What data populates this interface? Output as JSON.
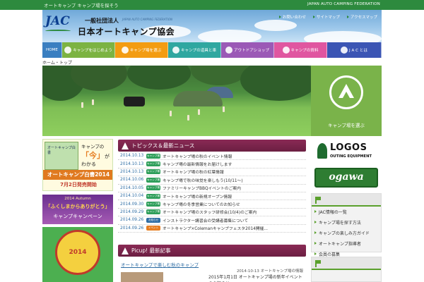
{
  "topbar": {
    "tagline": "オートキャンプ キャンプ場を探そう",
    "english_name": "JAPAN AUTO CAMPING FEDERATION"
  },
  "header": {
    "logo_text": "JAC",
    "org_prefix": "一般社団法人",
    "org_english": "JAPAN AUTO CAMPING FEDERATION",
    "org_name": "日本オートキャンプ協会",
    "links": [
      "お問い合わせ",
      "サイトマップ",
      "アクセスマップ"
    ]
  },
  "nav": [
    {
      "label": "HOME",
      "color": "#3a7fc1",
      "icon": "home"
    },
    {
      "label": "キャンプをはじめよう",
      "color": "#7cb342",
      "icon": "leaf-icon"
    },
    {
      "label": "キャンプ場を選ぶ",
      "color": "#f39c12",
      "icon": "tent-icon"
    },
    {
      "label": "キャンプの道具と車",
      "color": "#2fa7a0",
      "icon": "gear-icon"
    },
    {
      "label": "アウトドアショップ",
      "color": "#9b59b6",
      "icon": "shop-icon"
    },
    {
      "label": "キャンプの資料",
      "color": "#e056a0",
      "icon": "book-icon"
    },
    {
      "label": "J A C とは",
      "color": "#3b55b4",
      "icon": "question-icon"
    }
  ],
  "breadcrumb": "ホーム・トップ",
  "hero_cta": "キャンプ場を選ぶ",
  "banners": {
    "whitepaper": {
      "cover": "オートキャンプ白書",
      "line1": "キャンプの",
      "big": "「今」",
      "line2": "がわかる",
      "line3": "",
      "bar": "オートキャンプ白書2014",
      "date": "7月2日発売開始"
    },
    "campaign": {
      "line1": "2014 Autumn",
      "line2": "「ふくしまからありがとう」",
      "line3": "キャンプキャンペーン"
    },
    "event": {
      "year": "2014"
    }
  },
  "news": {
    "heading": "トピックス＆最新ニュース",
    "items": [
      {
        "date": "2014.10.13",
        "tag": "キャンプ場",
        "tag_color": "#2e9e5a",
        "title": "オートキャンプ場の秋のイベント情報"
      },
      {
        "date": "2014.10.13",
        "tag": "キャンプ場",
        "tag_color": "#2e9e5a",
        "title": "キャンプ場の最新情報をお届けします"
      },
      {
        "date": "2014.10.13",
        "tag": "キャンプ場",
        "tag_color": "#2e9e5a",
        "title": "オートキャンプ場の秋の紅葉情報"
      },
      {
        "date": "2014.10.06",
        "tag": "キャンプ場",
        "tag_color": "#2e9e5a",
        "title": "キャンプ場で秋の味覚を楽しもう(10/11～)"
      },
      {
        "date": "2014.10.05",
        "tag": "キャンプ場",
        "tag_color": "#2e9e5a",
        "title": "ファミリーキャンプBBQイベントのご案内"
      },
      {
        "date": "2014.10.04",
        "tag": "キャンプ場",
        "tag_color": "#2e9e5a",
        "title": "オートキャンプ場の新規オープン情報"
      },
      {
        "date": "2014.09.30",
        "tag": "キャンプ場",
        "tag_color": "#2e9e5a",
        "title": "キャンプ場の冬季営業についてのお知らせ"
      },
      {
        "date": "2014.09.29",
        "tag": "キャンプ場",
        "tag_color": "#2e9e5a",
        "title": "オートキャンプ場のスタッフ研修会(10/4)のご案内"
      },
      {
        "date": "2014.09.26",
        "tag": "お知らせ",
        "tag_color": "#2e6da4",
        "title": "インストラクター講習会の受講者募集について"
      },
      {
        "date": "2014.09.26",
        "tag": "イベント",
        "tag_color": "#e67e22",
        "title": "オートキャンプ×Colemanキャンプフェスタ2014開催..."
      }
    ]
  },
  "picup": {
    "heading": "Picup! 最新記事",
    "title": "オートキャンプで楽しむ秋のキャンプ",
    "meta": "2014-10-13 オートキャンプ場の情報",
    "excerpt": "2015年1月1日 オートキャンプ場の新年イベントのお知らせ"
  },
  "sponsors": {
    "logos": {
      "word": "LOGOS",
      "sub": "OUTING EQUIPMENT"
    },
    "ogawa": {
      "word": "ogawa"
    }
  },
  "sidebar": {
    "box1": {
      "links": [
        "JAC情報の一覧",
        "キャンプ場を探す方法",
        "キャンプの楽しみ方ガイド",
        "オートキャンプ指導者",
        "会員の募集"
      ]
    }
  }
}
